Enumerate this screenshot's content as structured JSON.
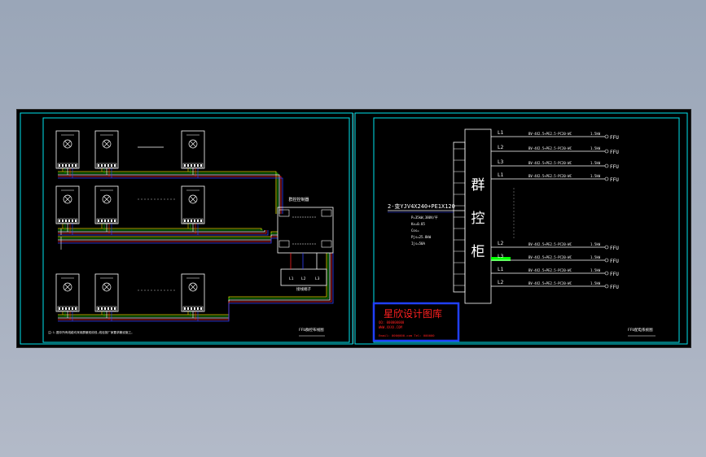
{
  "colors": {
    "background": "#000000",
    "frame": "#00e5ee",
    "white": "#ffffff",
    "yellow": "#e8e000",
    "green": "#00c800",
    "red": "#ff2020",
    "blue": "#3040ff",
    "bright_green": "#00ff00",
    "stamp_red": "#ff2020",
    "stamp_blue": "#2040ff"
  },
  "left_panel": {
    "controller_title": "群控控制器",
    "terminal_label": "接线端子",
    "terminals": [
      "L1",
      "L2",
      "L3"
    ],
    "footnote": "注:1.图中所有线缆均采用屏蔽双绞线,线径按厂家要求敷设施工。",
    "bottom_label": "FFU群控布线图"
  },
  "right_panel": {
    "cabinet_label": [
      "群",
      "控",
      "柜"
    ],
    "cable_label": "2-变YJV4X240+PE1X120",
    "cable_notes": [
      "P=35kW,380V/平",
      "Kx=0.85",
      "Cos=",
      "Pjs=25.8kW",
      "Ijs=50A"
    ],
    "circuits": [
      {
        "phase": "L1",
        "desc": "BV-4X2.5+PE2.5-PC20-WC",
        "power": "1.5kW",
        "target": "FFU"
      },
      {
        "phase": "L2",
        "desc": "BV-4X2.5+PE2.5-PC20-WC",
        "power": "1.5kW",
        "target": "FFU"
      },
      {
        "phase": "L3",
        "desc": "BV-4X2.5+PE2.5-PC20-WC",
        "power": "1.5kW",
        "target": "FFU"
      },
      {
        "phase": "L1",
        "desc": "BV-4X2.5+PE2.5-PC20-WC",
        "power": "1.5kW",
        "target": "FFU"
      },
      {
        "phase": "L2",
        "desc": "BV-4X2.5+PE2.5-PC20-WC",
        "power": "1.5kW",
        "target": "FFU"
      },
      {
        "phase": "L3",
        "desc": "BV-4X2.5+PE2.5-PC20-WC",
        "power": "1.5kW",
        "target": "FFU"
      },
      {
        "phase": "L1",
        "desc": "BV-4X2.5+PE2.5-PC20-WC",
        "power": "1.5kW",
        "target": "FFU"
      },
      {
        "phase": "L2",
        "desc": "BV-4X2.5+PE2.5-PC20-WC",
        "power": "1.5kW",
        "target": "FFU"
      }
    ],
    "bottom_label": "FFU配电系统图"
  },
  "stamp": {
    "title": "星欣设计图库",
    "line1": "QQ: 000000000",
    "line2": "WWW.XXXX.COM",
    "line3": "Email: 000@000.com  Tel: 000000"
  }
}
